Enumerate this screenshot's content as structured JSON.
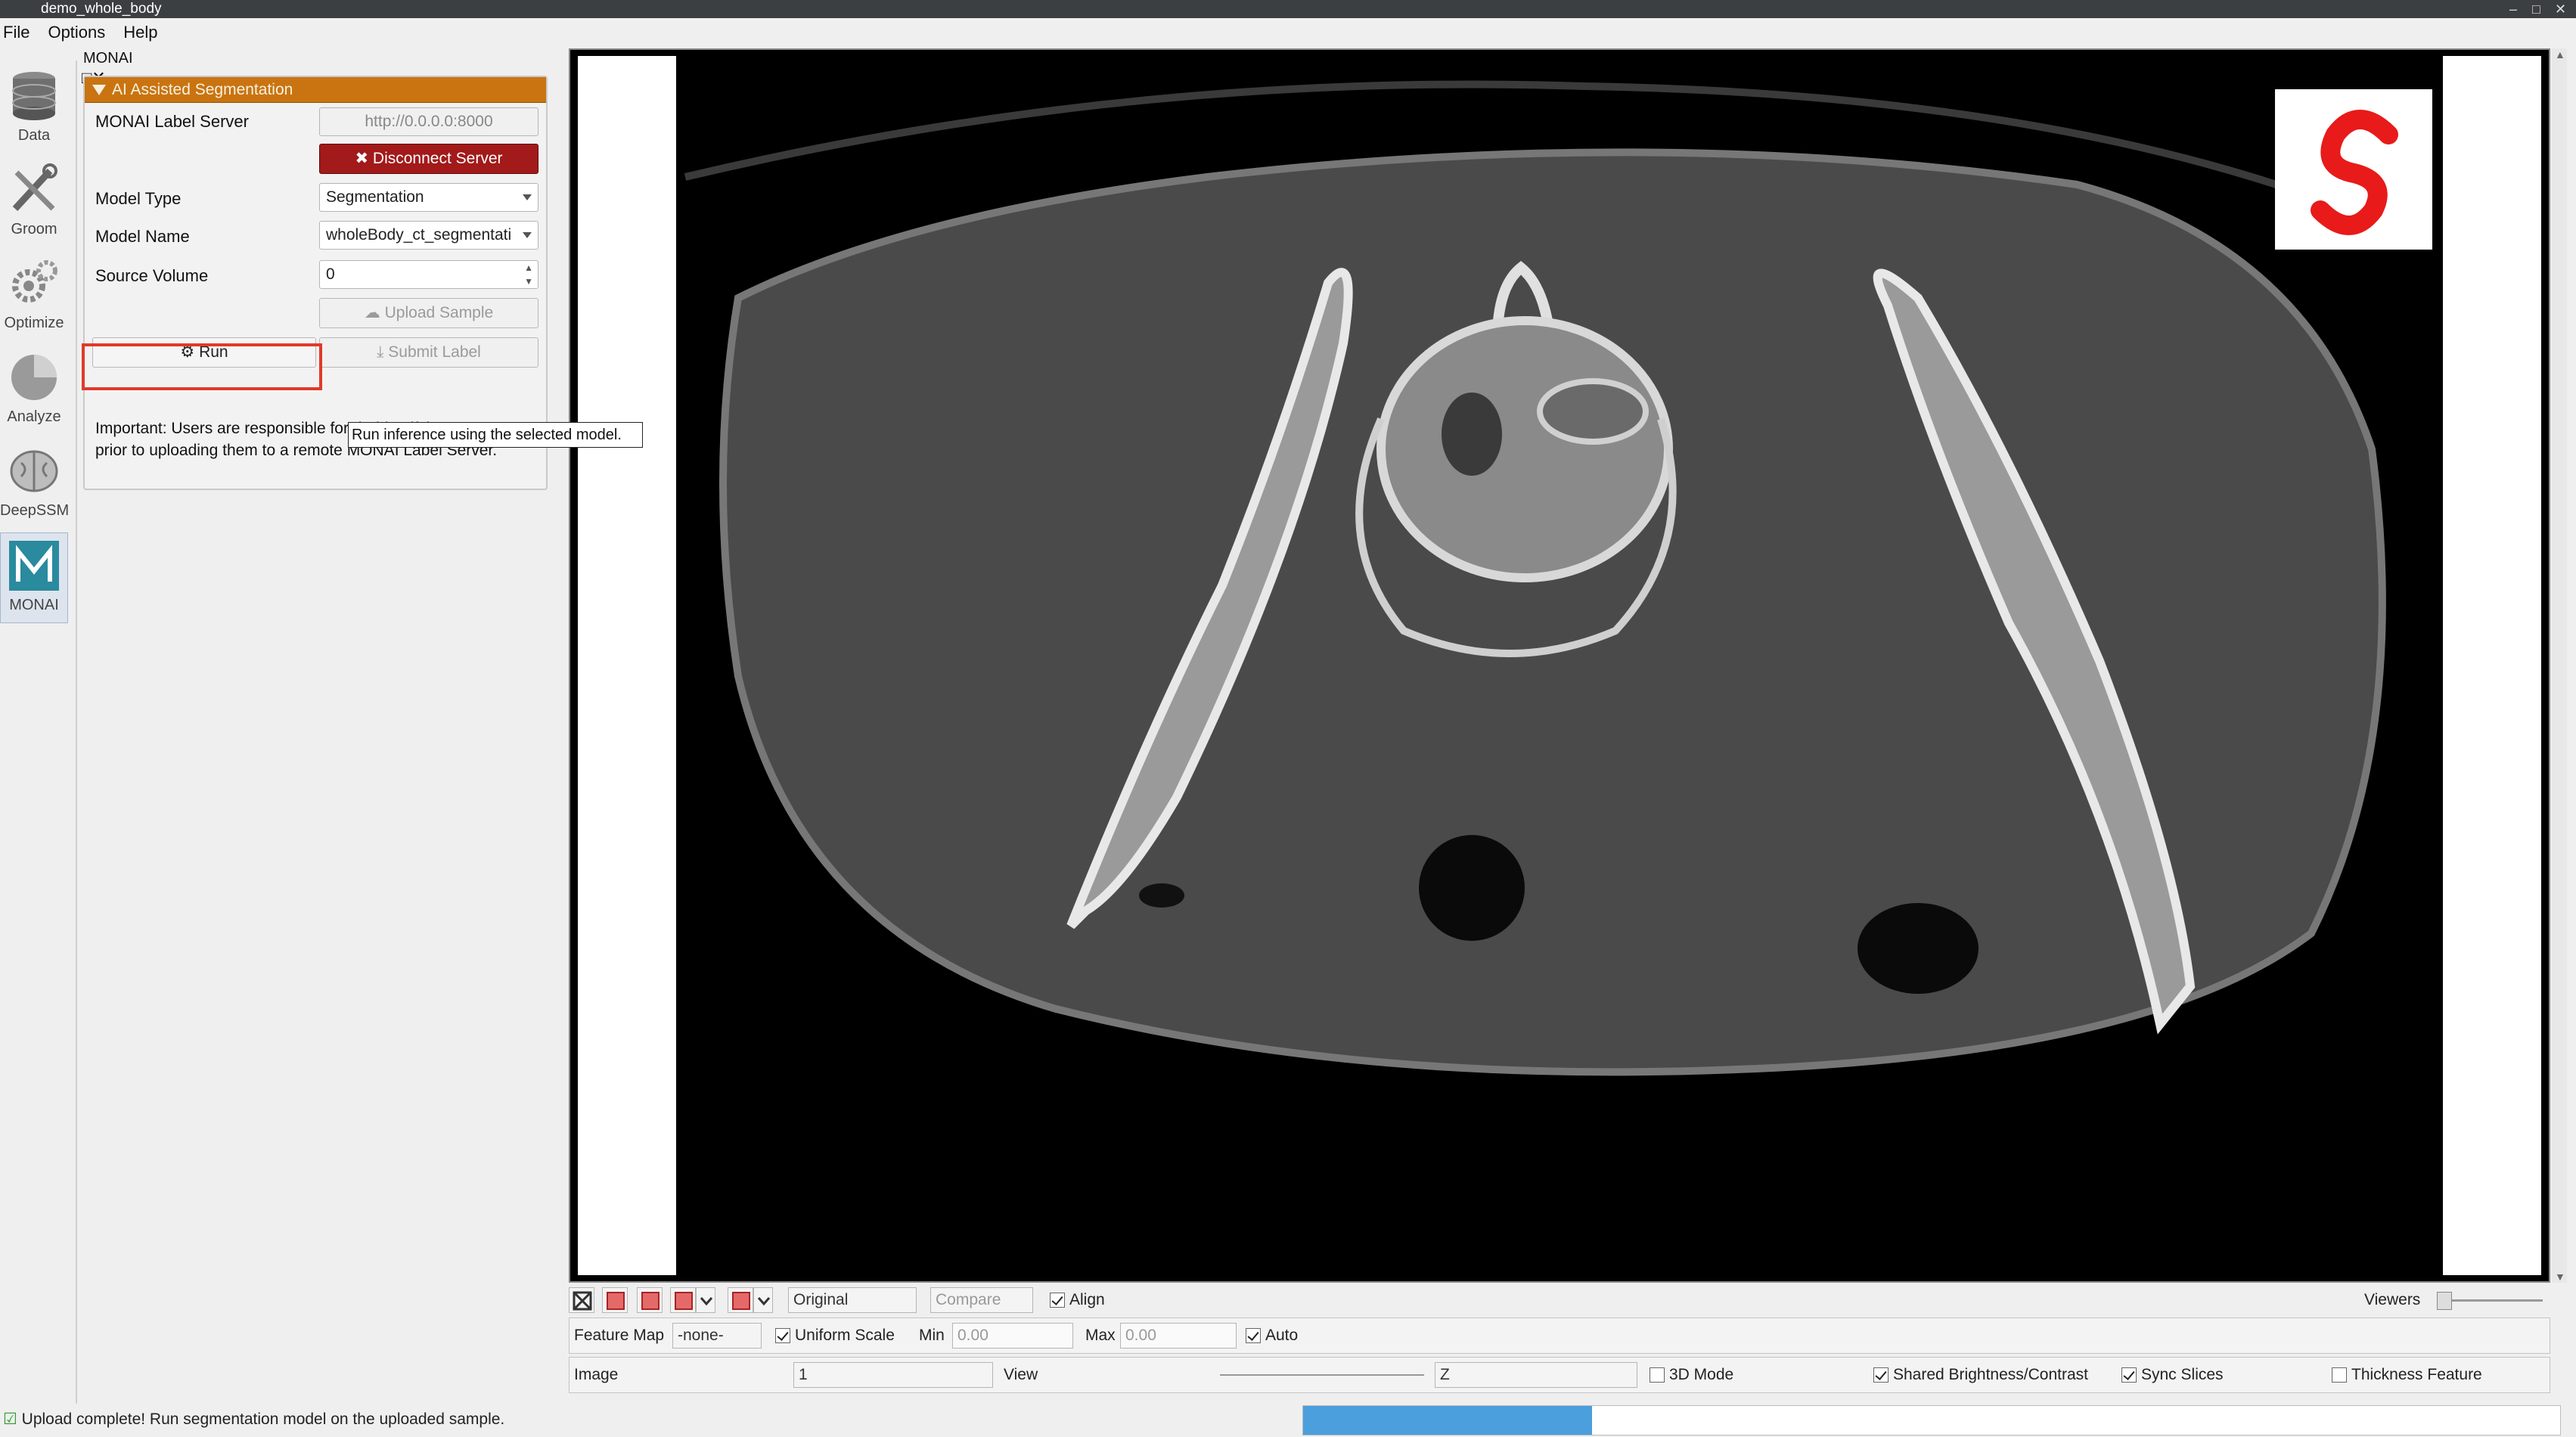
{
  "window": {
    "title": "demo_whole_body"
  },
  "menu": [
    "File",
    "Options",
    "Help"
  ],
  "tools": [
    {
      "label": "Data"
    },
    {
      "label": "Groom"
    },
    {
      "label": "Optimize"
    },
    {
      "label": "Analyze"
    },
    {
      "label": "DeepSSM"
    },
    {
      "label": "MONAI"
    }
  ],
  "panel": {
    "title": "MONAI",
    "section": "AI Assisted Segmentation",
    "server_label": "MONAI Label Server",
    "server_url": "http://0.0.0.0:8000",
    "disconnect": "Disconnect Server",
    "model_type_label": "Model Type",
    "model_type": "Segmentation",
    "model_name_label": "Model Name",
    "model_name": "wholeBody_ct_segmentati",
    "source_label": "Source Volume",
    "source_value": "0",
    "upload": "Upload Sample",
    "run": "Run",
    "submit": "Submit Label",
    "tooltip": "Run inference using the selected model.",
    "note": "Important: Users are responsible for de-identifying scans prior to uploading them to a remote MONAI Label Server."
  },
  "viewer": {
    "viewers_label": "Viewers"
  },
  "toolbar": {
    "display_mode": "Original",
    "compare": "Compare",
    "align": "Align"
  },
  "featuremap": {
    "label": "Feature Map",
    "value": "-none-",
    "uniform": "Uniform Scale",
    "min_label": "Min",
    "min": "0.00",
    "max_label": "Max",
    "max": "0.00",
    "auto": "Auto"
  },
  "imagerow": {
    "image_label": "Image",
    "image_value": "1",
    "view_label": "View",
    "axis": "Z",
    "mode3d": "3D Mode",
    "shared": "Shared Brightness/Contrast",
    "sync": "Sync Slices",
    "thickness": "Thickness Feature"
  },
  "status": {
    "message": "Upload complete! Run segmentation model on the uploaded sample.",
    "progress": 0.23
  },
  "colors": {
    "accent": "#c97410",
    "danger": "#a21a1a",
    "highlight": "#e03a2a",
    "progress": "#4a9fdc"
  }
}
